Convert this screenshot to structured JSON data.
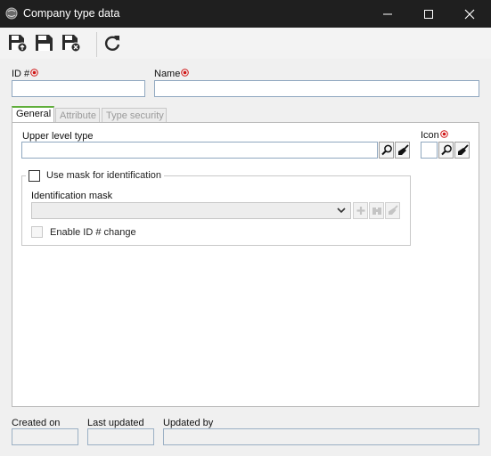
{
  "window": {
    "title": "Company type data",
    "controls": [
      "minimize",
      "maximize",
      "close"
    ]
  },
  "toolbar": {
    "buttons": [
      {
        "name": "save-and-new-button",
        "icon": "floppy-plus-icon"
      },
      {
        "name": "save-button",
        "icon": "floppy-icon"
      },
      {
        "name": "save-and-close-button",
        "icon": "floppy-close-icon"
      },
      {
        "name": "refresh-button",
        "icon": "refresh-icon"
      }
    ]
  },
  "form": {
    "id_label": "ID #",
    "id_value": "",
    "name_label": "Name",
    "name_value": ""
  },
  "tabs": [
    {
      "label": "General",
      "active": true
    },
    {
      "label": "Attribute",
      "active": false
    },
    {
      "label": "Type security",
      "active": false
    }
  ],
  "general": {
    "upper_level_label": "Upper level type",
    "upper_level_value": "",
    "icon_label": "Icon",
    "use_mask_label": "Use mask for identification",
    "use_mask_checked": false,
    "identification_mask_label": "Identification mask",
    "identification_mask_value": "",
    "enable_id_change_label": "Enable ID # change",
    "enable_id_change_checked": false
  },
  "footer": {
    "created_on_label": "Created on",
    "created_on_value": "",
    "last_updated_label": "Last updated",
    "last_updated_value": "",
    "updated_by_label": "Updated by",
    "updated_by_value": ""
  },
  "colors": {
    "titlebar": "#1f1f1f",
    "required": "#d01515",
    "active_tab_accent": "#5fae3a",
    "input_border": "#8fa7bf"
  }
}
